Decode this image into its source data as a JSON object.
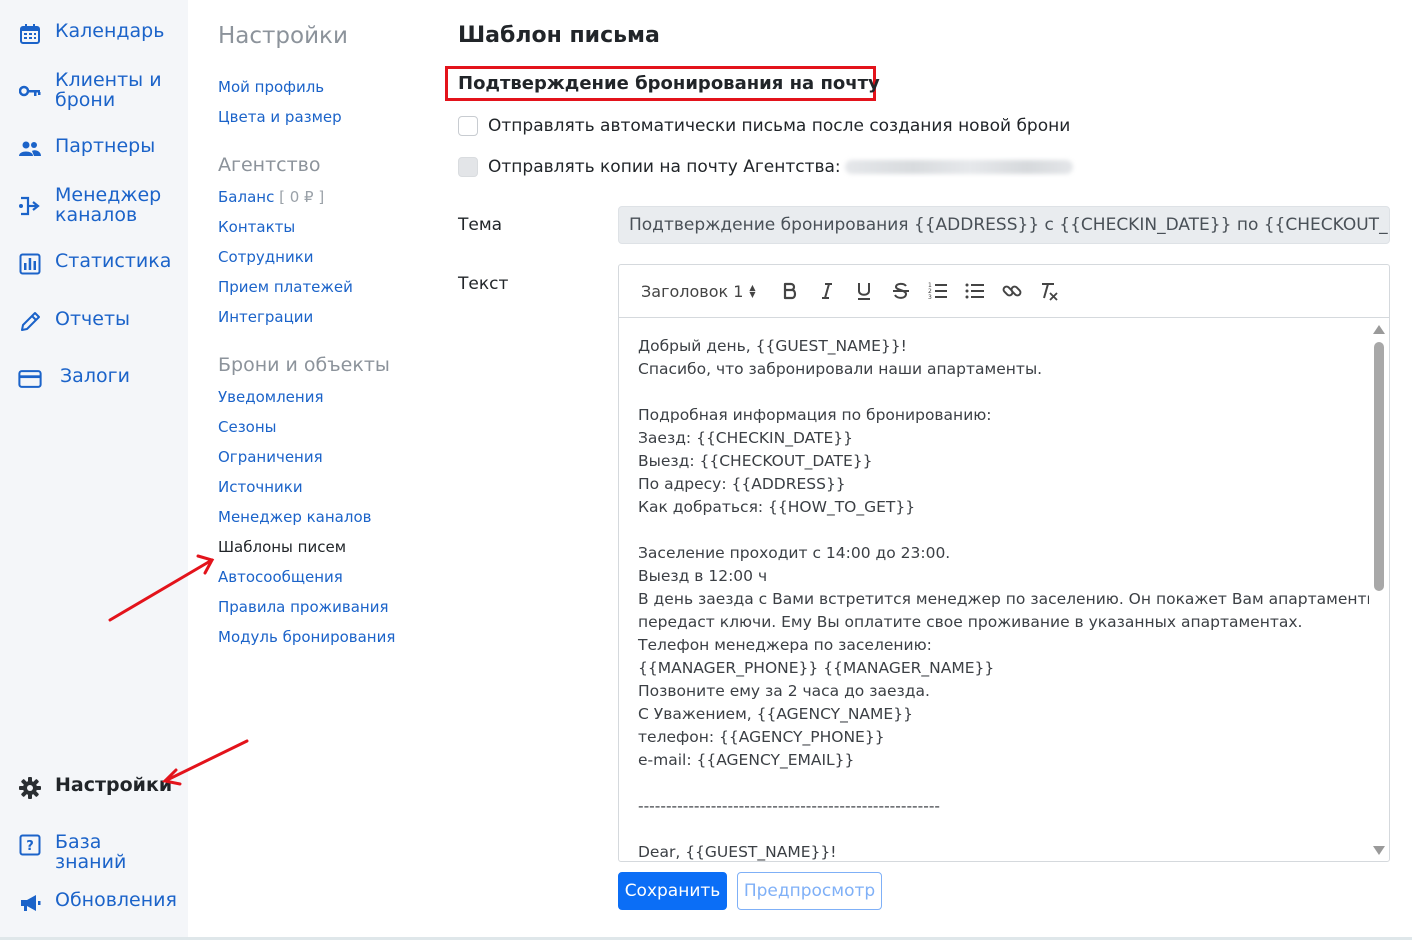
{
  "sidebar": {
    "items": [
      {
        "label": "Календарь",
        "icon": "calendar-icon"
      },
      {
        "label": "Клиенты и брони",
        "icon": "key-icon"
      },
      {
        "label": "Партнеры",
        "icon": "people-icon"
      },
      {
        "label": "Менеджер каналов",
        "icon": "channels-icon"
      },
      {
        "label": "Статистика",
        "icon": "bar-chart-icon"
      },
      {
        "label": "Отчеты",
        "icon": "pencil-icon"
      },
      {
        "label": "Залоги",
        "icon": "card-icon"
      }
    ],
    "bottom_items": [
      {
        "label": "Настройки",
        "icon": "gear-icon"
      },
      {
        "label": "База знаний",
        "icon": "question-icon"
      },
      {
        "label": "Обновления",
        "icon": "megaphone-icon"
      }
    ],
    "accent_color": "#1b63c9"
  },
  "settings": {
    "title": "Настройки",
    "profile_links": [
      "Мой профиль",
      "Цвета и размер"
    ],
    "agency_section": "Агентство",
    "agency_links": {
      "balance": "Баланс",
      "balance_value": "[ 0 ₽ ]",
      "contacts": "Контакты",
      "staff": "Сотрудники",
      "payments": "Прием платежей",
      "integrations": "Интеграции"
    },
    "bookings_section": "Брони и объекты",
    "bookings_links": [
      "Уведомления",
      "Сезоны",
      "Ограничения",
      "Источники",
      "Менеджер каналов",
      "Шаблоны писем",
      "Автосообщения",
      "Правила проживания",
      "Модуль бронирования"
    ],
    "current_link": "Шаблоны писем"
  },
  "main": {
    "title": "Шаблон письма",
    "template_name": "Подтверждение бронирования на почту",
    "auto_send_label": "Отправлять автоматически письма после создания новой брони",
    "copy_to_agency_label": "Отправлять копии на почту Агентства:",
    "subject_label": "Тема",
    "subject_value": "Подтверждение бронирования {{ADDRESS}} с {{CHECKIN_DATE}} по {{CHECKOUT_DATE}}",
    "text_label": "Текст",
    "editor": {
      "heading_select": "Заголовок 1",
      "lines": [
        "Добрый день, {{GUEST_NAME}}!",
        "Спасибо, что забронировали наши апартаменты.",
        "",
        "Подробная информация по бронированию:",
        "Заезд: {{CHECKIN_DATE}}",
        "Выезд: {{CHECKOUT_DATE}}",
        "По адресу: {{ADDRESS}}",
        "Как добраться: {{HOW_TO_GET}}",
        "",
        "Заселение проходит с 14:00 до 23:00.",
        "Выезд в 12:00 ч",
        "В день заезда с Вами встретится менеджер по заселению. Он покажет Вам апартаменты и",
        "передаст ключи. Ему Вы оплатите свое проживание в указанных апартаментах.",
        "Телефон менеджера по заселению:",
        "{{MANAGER_PHONE}} {{MANAGER_NAME}}",
        "Позвоните ему за 2 часа до заезда.",
        "С Уважением, {{AGENCY_NAME}}",
        "телефон: {{AGENCY_PHONE}}",
        "e-mail: {{AGENCY_EMAIL}}",
        "",
        "------------------------------------------------------",
        "",
        "Dear, {{GUEST_NAME}}!"
      ]
    },
    "save_button": "Сохранить",
    "preview_button": "Предпросмотр",
    "primary_color": "#0b6ef6",
    "highlight_color": "#e3131b"
  }
}
